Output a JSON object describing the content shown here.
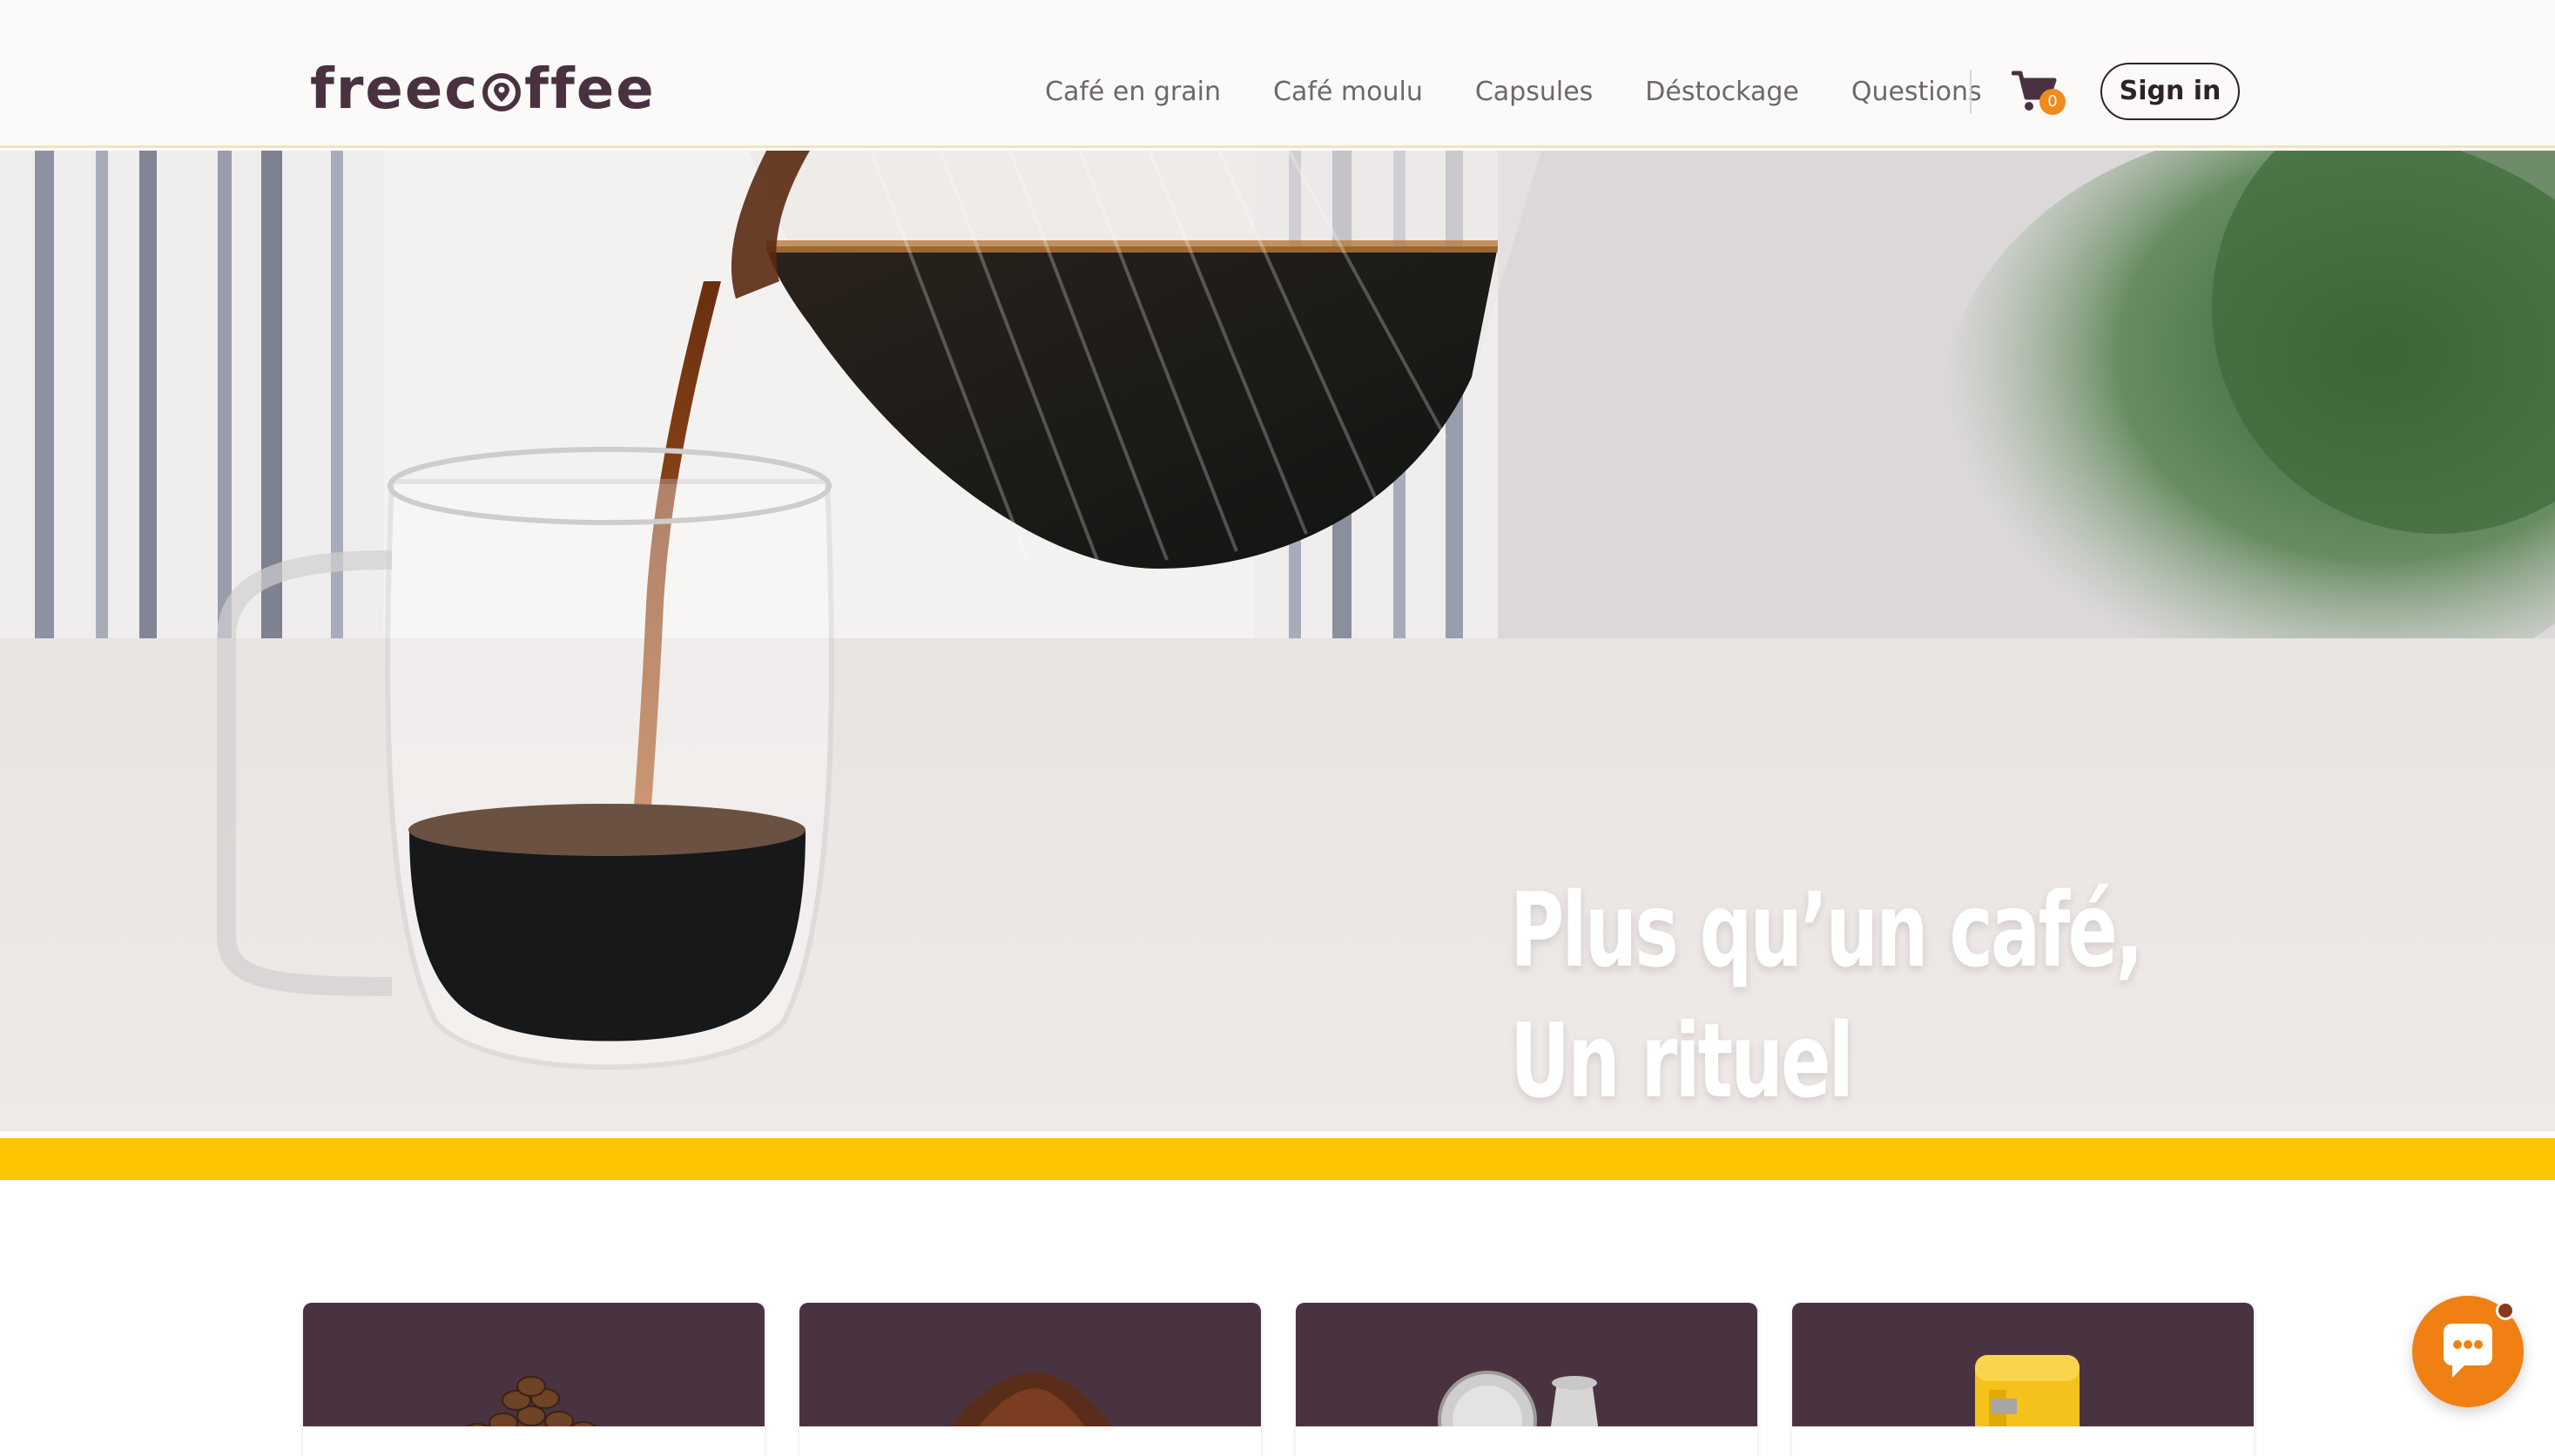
{
  "brand": {
    "logo_text_before": "freec",
    "logo_text_after": "ffee",
    "logo_text": "freecoffee"
  },
  "nav": {
    "items": [
      {
        "label": "Café en grain"
      },
      {
        "label": "Café moulu"
      },
      {
        "label": "Capsules"
      },
      {
        "label": "Déstockage"
      },
      {
        "label": "Questions"
      }
    ]
  },
  "cart": {
    "count": "0",
    "icon": "cart-icon"
  },
  "signin": {
    "label": "Sign in"
  },
  "hero": {
    "title_line1": "Plus qu’un café,",
    "title_line2": "Un rituel"
  },
  "categories": [
    {
      "icon": "coffee-beans-image"
    },
    {
      "icon": "ground-coffee-image"
    },
    {
      "icon": "coffee-capsules-image"
    },
    {
      "icon": "coffee-machine-image"
    }
  ],
  "chat": {
    "icon": "chat-bubble-icon"
  },
  "colors": {
    "brand_plum": "#4a3340",
    "accent_yellow": "#fdc500",
    "accent_orange": "#f08014",
    "header_bg": "#fbfaf8"
  }
}
